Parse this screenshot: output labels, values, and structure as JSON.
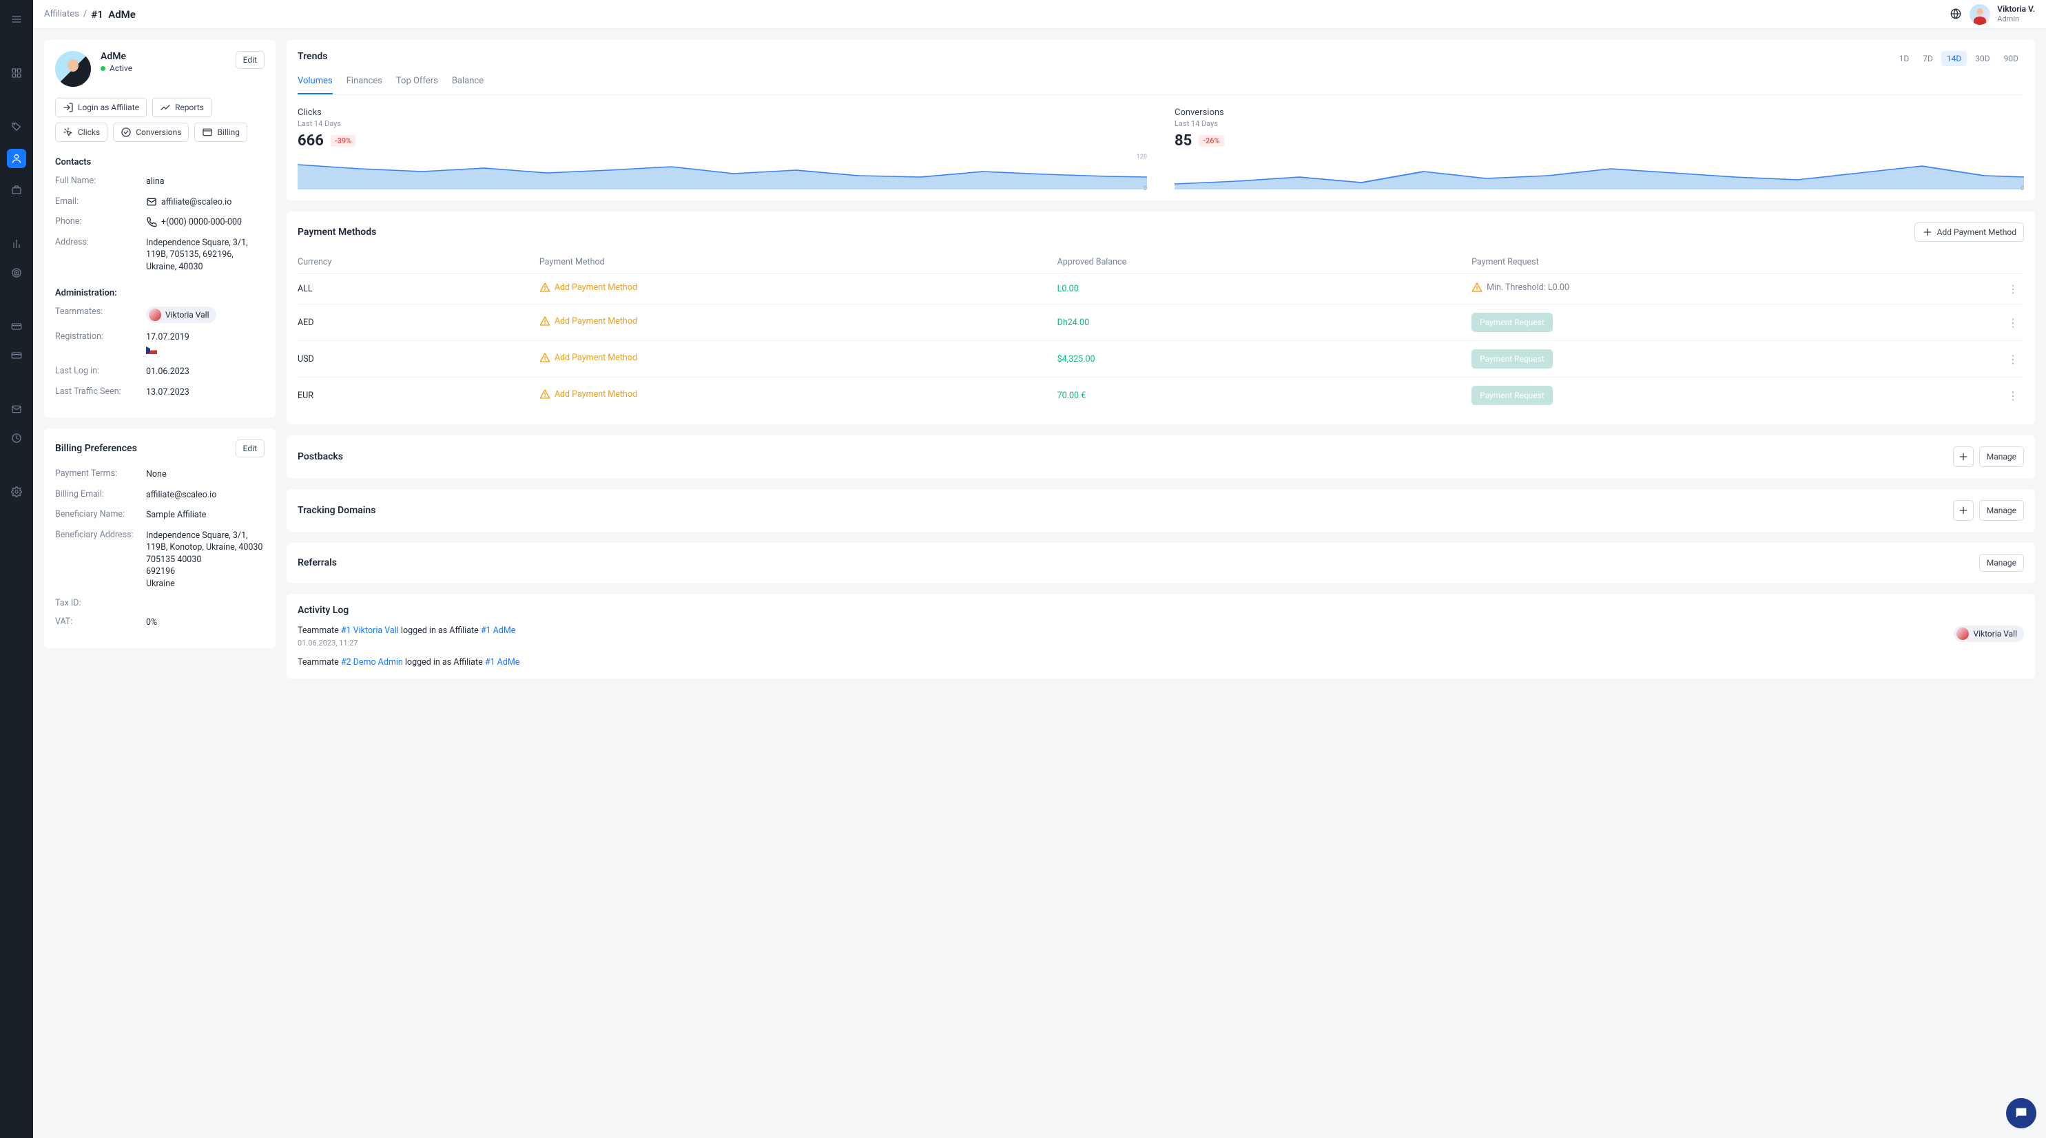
{
  "breadcrumb": {
    "parent": "Affiliates",
    "sep": "/",
    "id": "#1",
    "name": "AdMe"
  },
  "header": {
    "user_name": "Viktoria V.",
    "user_role": "Admin"
  },
  "profile": {
    "name": "AdMe",
    "status": "Active",
    "edit": "Edit",
    "actions": {
      "login": "Login as Affiliate",
      "reports": "Reports",
      "clicks": "Clicks",
      "conversions": "Conversions",
      "billing": "Billing"
    },
    "contacts_h": "Contacts",
    "fullname_k": "Full Name:",
    "fullname_v": "alina",
    "email_k": "Email:",
    "email_v": "affiliate@scaleo.io",
    "phone_k": "Phone:",
    "phone_v": "+(000) 0000-000-000",
    "addr_k": "Address:",
    "addr_v": "Independence Square, 3/1, 119B, 705135, 692196, Ukraine, 40030",
    "admin_h": "Administration:",
    "team_k": "Teammates:",
    "team_v": "Viktoria Vall",
    "reg_k": "Registration:",
    "reg_v": "17.07.2019",
    "login_k": "Last Log in:",
    "login_v": "01.06.2023",
    "traffic_k": "Last Traffic Seen:",
    "traffic_v": "13.07.2023"
  },
  "billing": {
    "title": "Billing Preferences",
    "edit": "Edit",
    "terms_k": "Payment Terms:",
    "terms_v": "None",
    "email_k": "Billing Email:",
    "email_v": "affiliate@scaleo.io",
    "bname_k": "Beneficiary Name:",
    "bname_v": "Sample Affiliate",
    "baddr_k": "Beneficiary Address:",
    "baddr_v": "Independence Square, 3/1, 119B, Konotop, Ukraine, 40030\n705135 40030\n692196\nUkraine",
    "tax_k": "Tax ID:",
    "tax_v": "",
    "vat_k": "VAT:",
    "vat_v": "0%"
  },
  "trends": {
    "title": "Trends",
    "ranges": [
      "1D",
      "7D",
      "14D",
      "30D",
      "90D"
    ],
    "range_active": "14D",
    "tabs": [
      "Volumes",
      "Finances",
      "Top Offers",
      "Balance"
    ],
    "tab_active": "Volumes",
    "clicks": {
      "label": "Clicks",
      "sub": "Last 14 Days",
      "value": "666",
      "delta": "-39%",
      "ymax": "120",
      "ymin": "0"
    },
    "conv": {
      "label": "Conversions",
      "sub": "Last 14 Days",
      "value": "85",
      "delta": "-26%",
      "ymax": "",
      "ymin": "0"
    }
  },
  "pm": {
    "title": "Payment Methods",
    "add": "Add Payment Method",
    "cols": {
      "currency": "Currency",
      "method": "Payment Method",
      "approved": "Approved Balance",
      "request": "Payment Request"
    },
    "add_link": "Add Payment Method",
    "pay_btn": "Payment Request",
    "thresh": "Min. Threshold: L0.00",
    "rows": [
      {
        "cur": "ALL",
        "bal": "L0.00"
      },
      {
        "cur": "AED",
        "bal": "Dh24.00"
      },
      {
        "cur": "USD",
        "bal": "$4,325.00"
      },
      {
        "cur": "EUR",
        "bal": "70.00 €"
      }
    ]
  },
  "postbacks": {
    "title": "Postbacks",
    "manage": "Manage"
  },
  "tracking": {
    "title": "Tracking Domains",
    "manage": "Manage"
  },
  "referrals": {
    "title": "Referrals",
    "manage": "Manage"
  },
  "activity": {
    "title": "Activity Log",
    "items": [
      {
        "pre": "Teammate ",
        "link1": "#1 Viktoria Vall",
        "mid": " logged in as Affiliate ",
        "link2": "#1 AdMe",
        "ts": "01.06.2023, 11:27",
        "chip": "Viktoria Vall"
      },
      {
        "pre": "Teammate ",
        "link1": "#2 Demo Admin",
        "mid": " logged in as Affiliate ",
        "link2": "#1 AdMe",
        "ts": "",
        "chip": ""
      }
    ]
  },
  "chart_data": [
    {
      "type": "area",
      "title": "Clicks Last 14 Days",
      "ylim": [
        0,
        120
      ],
      "values": [
        70,
        58,
        50,
        62,
        48,
        55,
        68,
        46,
        55,
        42,
        38,
        50,
        44,
        40
      ]
    },
    {
      "type": "area",
      "title": "Conversions Last 14 Days",
      "ylim": [
        0,
        12
      ],
      "values": [
        3,
        4,
        5,
        3,
        6,
        4,
        5,
        7,
        6,
        5,
        4,
        6,
        8,
        5
      ]
    }
  ]
}
